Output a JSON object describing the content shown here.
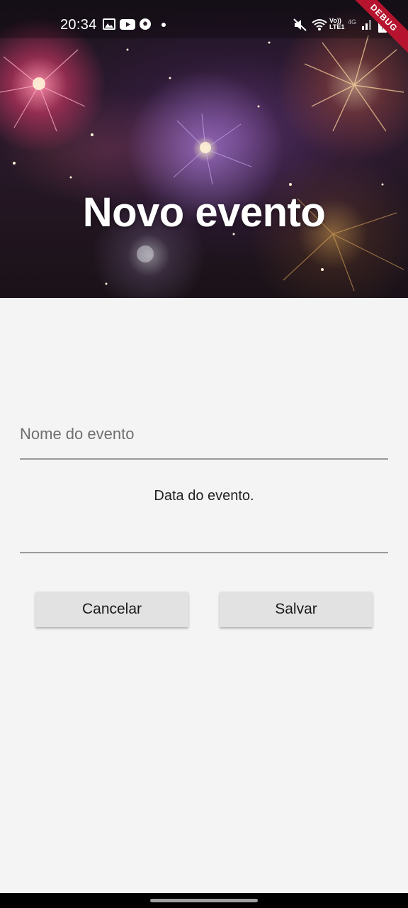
{
  "status_bar": {
    "time": "20:34",
    "network_label": "Vo)) LTE1",
    "network_type": "4G",
    "left_icons": [
      "image-icon",
      "youtube-icon",
      "soccer-ball-icon",
      "dot-icon"
    ],
    "right_icons": [
      "mute-icon",
      "wifi-icon",
      "signal-icon",
      "battery-charging-icon"
    ]
  },
  "debug_banner": "DEBUG",
  "header": {
    "title": "Novo evento"
  },
  "form": {
    "name_placeholder": "Nome do evento",
    "name_value": "",
    "date_label": "Data do evento.",
    "date_value": ""
  },
  "buttons": {
    "cancel_label": "Cancelar",
    "save_label": "Salvar"
  },
  "colors": {
    "background": "#f4f4f4",
    "button_bg": "#e2e2e2",
    "underline": "#9a9a9a",
    "debug_banner": "#b6142e"
  }
}
